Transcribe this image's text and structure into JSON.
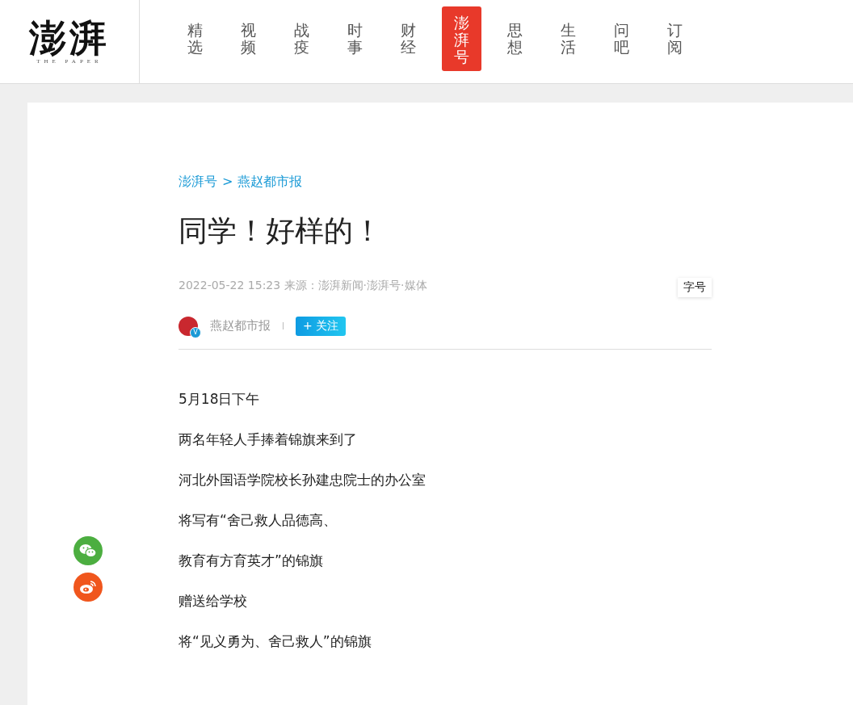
{
  "logo": {
    "text": "澎湃",
    "subtitle": "THE PAPER"
  },
  "nav": [
    {
      "label": "精选",
      "selected": false
    },
    {
      "label": "视频",
      "selected": false
    },
    {
      "label": "战疫",
      "selected": false
    },
    {
      "label": "时事",
      "selected": false
    },
    {
      "label": "财经",
      "selected": false
    },
    {
      "label": "澎湃号",
      "selected": true
    },
    {
      "label": "思想",
      "selected": false
    },
    {
      "label": "生活",
      "selected": false
    },
    {
      "label": "问吧",
      "selected": false
    },
    {
      "label": "订阅",
      "selected": false
    }
  ],
  "breadcrumb": {
    "items": [
      "澎湃号",
      "燕赵都市报"
    ],
    "separator": ">"
  },
  "article": {
    "title": "同学！好样的！",
    "meta": "2022-05-22 15:23 来源：澎湃新闻·澎湃号·媒体",
    "font_size_button": "字号",
    "author": {
      "name": "燕赵都市报",
      "verified_badge": "V",
      "follow_button": "+ 关注"
    },
    "paragraphs": [
      "5月18日下午",
      "两名年轻人手捧着锦旗来到了",
      "河北外国语学院校长孙建忠院士的办公室",
      "将写有“舍己救人品德高、",
      "教育有方育英才”的锦旗",
      "赠送给学校",
      "将“见义勇为、舍己救人”的锦旗"
    ]
  }
}
